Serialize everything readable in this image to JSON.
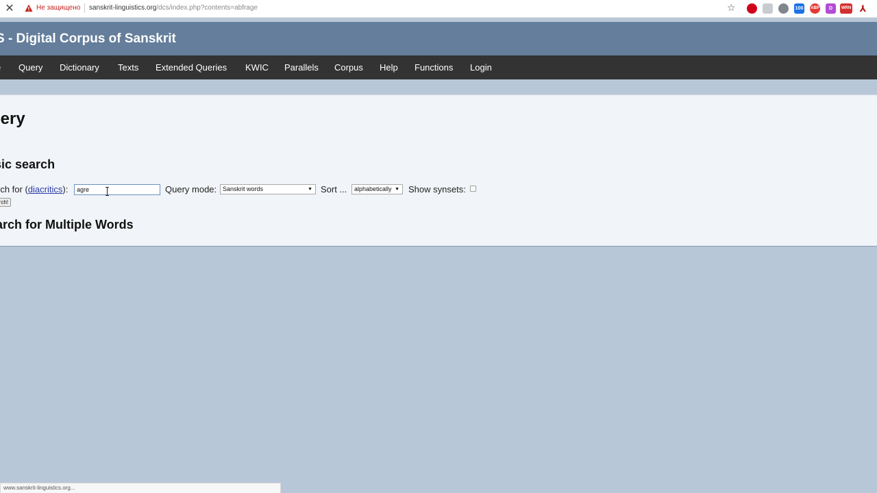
{
  "browser": {
    "security_label": "Не защищено",
    "url_host": "sanskrit-linguistics.org",
    "url_path": "/dcs/index.php?contents=abfrage",
    "extensions": [
      {
        "name": "opera-icon",
        "color": "#d0021b",
        "label": ""
      },
      {
        "name": "extension-icon",
        "color": "#9aa0a6",
        "label": ""
      },
      {
        "name": "globe-icon",
        "color": "#80868b",
        "label": ""
      },
      {
        "name": "counter-icon",
        "color": "#1a73e8",
        "label": "100"
      },
      {
        "name": "adblock-icon",
        "color": "#e53935",
        "label": "ABP"
      },
      {
        "name": "d-icon",
        "color": "#b24bd6",
        "label": "D"
      },
      {
        "name": "wrn-icon",
        "color": "#d32f2f",
        "label": "WRN"
      },
      {
        "name": "pdf-icon",
        "color": "#b71c1c",
        "label": ""
      }
    ]
  },
  "site": {
    "title": "S - Digital Corpus of Sanskrit"
  },
  "nav": {
    "items": [
      {
        "label": "e",
        "id": "home"
      },
      {
        "label": "Query",
        "id": "query"
      },
      {
        "label": "Dictionary",
        "id": "dictionary"
      },
      {
        "label": "Texts",
        "id": "texts"
      },
      {
        "label": "Extended Queries",
        "id": "extended-queries"
      },
      {
        "label": "KWIC",
        "id": "kwic"
      },
      {
        "label": "Parallels",
        "id": "parallels"
      },
      {
        "label": "Corpus",
        "id": "corpus"
      },
      {
        "label": "Help",
        "id": "help"
      },
      {
        "label": "Functions",
        "id": "functions"
      },
      {
        "label": "Login",
        "id": "login"
      }
    ]
  },
  "main": {
    "page_title": "uery",
    "basic_search_title": "sic search",
    "search_for_prefix": "rch for (",
    "diacritics_link": "diacritics",
    "search_for_suffix": "):",
    "search_value": "agre",
    "query_mode_label": "Query mode:",
    "query_mode_value": "Sanskrit words",
    "sort_label": "Sort ...",
    "sort_value": "alphabetically",
    "show_synsets_label": "Show synsets:",
    "show_synsets_checked": false,
    "search_button_label": "rch!",
    "multiple_words_title": "arch for Multiple Words"
  },
  "status_bar": {
    "text": "www.sanskrit-linguistics.org..."
  }
}
